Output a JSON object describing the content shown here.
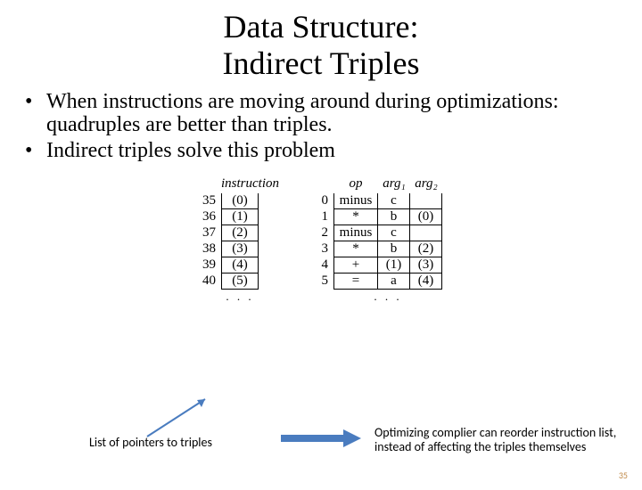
{
  "title_line1": "Data Structure:",
  "title_line2": "Indirect Triples",
  "bullets": [
    "When instructions are moving around during optimizations: quadruples are better than triples.",
    "Indirect triples solve this problem"
  ],
  "left_table": {
    "header": "instruction",
    "rows": [
      {
        "idx": "35",
        "val": "(0)"
      },
      {
        "idx": "36",
        "val": "(1)"
      },
      {
        "idx": "37",
        "val": "(2)"
      },
      {
        "idx": "38",
        "val": "(3)"
      },
      {
        "idx": "39",
        "val": "(4)"
      },
      {
        "idx": "40",
        "val": "(5)"
      }
    ],
    "dots": ". . ."
  },
  "right_table": {
    "headers": {
      "op": "op",
      "arg1": "arg₁",
      "arg2": "arg₂"
    },
    "rows": [
      {
        "idx": "0",
        "op": "minus",
        "a1": "c",
        "a2": ""
      },
      {
        "idx": "1",
        "op": "*",
        "a1": "b",
        "a2": "(0)"
      },
      {
        "idx": "2",
        "op": "minus",
        "a1": "c",
        "a2": ""
      },
      {
        "idx": "3",
        "op": "*",
        "a1": "b",
        "a2": "(2)"
      },
      {
        "idx": "4",
        "op": "+",
        "a1": "(1)",
        "a2": "(3)"
      },
      {
        "idx": "5",
        "op": "=",
        "a1": "a",
        "a2": "(4)"
      }
    ],
    "dots": ". . ."
  },
  "caption_left": "List of pointers to triples",
  "caption_right": "Optimizing complier can reorder instruction list, instead of affecting the triples themselves",
  "page_number": "35"
}
